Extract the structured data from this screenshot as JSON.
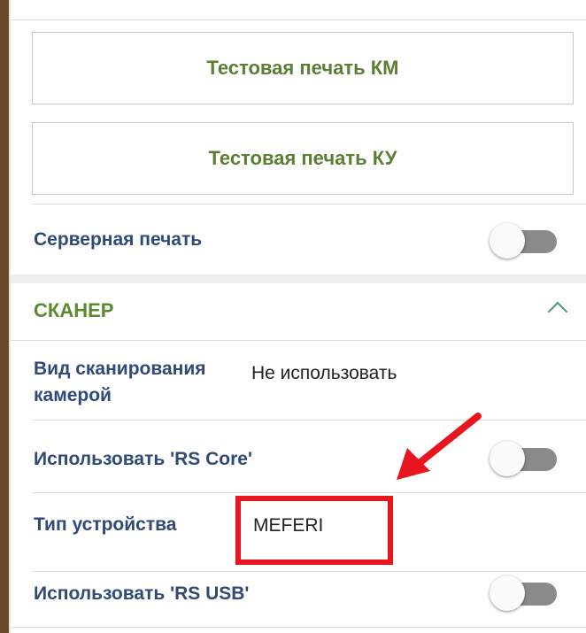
{
  "printer": {
    "test_print_km": "Тестовая печать КМ",
    "test_print_ku": "Тестовая печать КУ",
    "server_print_label": "Серверная печать",
    "server_print_enabled": false
  },
  "scanner": {
    "section_title": "СКАНЕР",
    "camera_scan_label_line1": "Вид сканирования",
    "camera_scan_label_line2": "камерой",
    "camera_scan_value": "Не использовать",
    "rs_core_label": "Использовать 'RS Core'",
    "rs_core_enabled": false,
    "device_type_label": "Тип устройства",
    "device_type_value": "MEFERI",
    "rs_usb_label": "Использовать 'RS USB'",
    "rs_usb_enabled": false
  },
  "colors": {
    "button_text": "#5a7f33",
    "label_text": "#2f4a7a",
    "section_title": "#5a8a2e",
    "annotation_red": "#e8141e"
  }
}
